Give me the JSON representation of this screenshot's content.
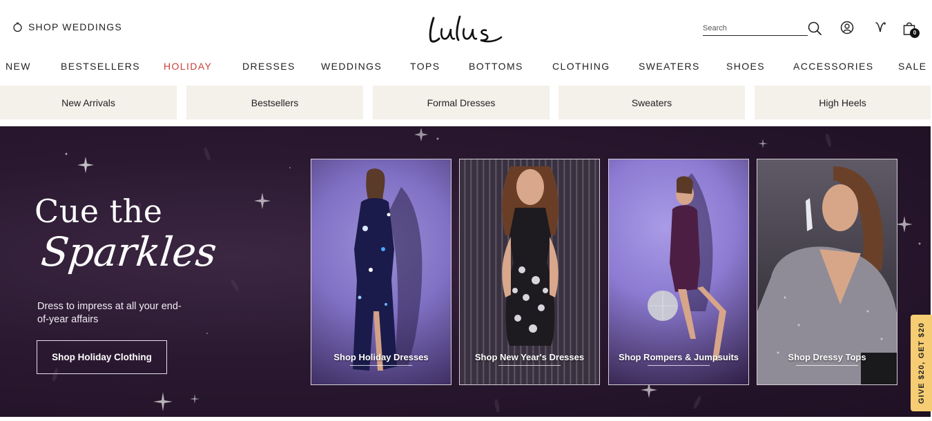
{
  "header": {
    "shop_weddings_label": "SHOP WEDDINGS",
    "logo_text": "Lulus",
    "search_placeholder": "Search",
    "cart_count": "0",
    "icons": [
      "ring-icon",
      "search-icon",
      "account-icon",
      "wishlist-icon",
      "shopping-bag-icon"
    ]
  },
  "nav": {
    "items": [
      "NEW",
      "BESTSELLERS",
      "HOLIDAY",
      "DRESSES",
      "WEDDINGS",
      "TOPS",
      "BOTTOMS",
      "CLOTHING",
      "SWEATERS",
      "SHOES",
      "ACCESSORIES",
      "SALE"
    ],
    "highlight_color": "#c94135"
  },
  "quick_links": [
    "New Arrivals",
    "Bestsellers",
    "Formal Dresses",
    "Sweaters",
    "High Heels"
  ],
  "hero": {
    "title_line1": "Cue the",
    "title_line2": "Sparkles",
    "subtitle": "Dress to impress at all your end-of-year affairs",
    "cta_label": "Shop Holiday Clothing",
    "background_color": "#2a1830"
  },
  "cards": [
    {
      "label": "Shop Holiday Dresses"
    },
    {
      "label": "Shop New Year's Dresses"
    },
    {
      "label": "Shop Rompers & Jumpsuits"
    },
    {
      "label": "Shop Dressy Tops"
    }
  ],
  "side_tab": {
    "label": "GIVE $20, GET $20",
    "color": "#f7cd73"
  }
}
